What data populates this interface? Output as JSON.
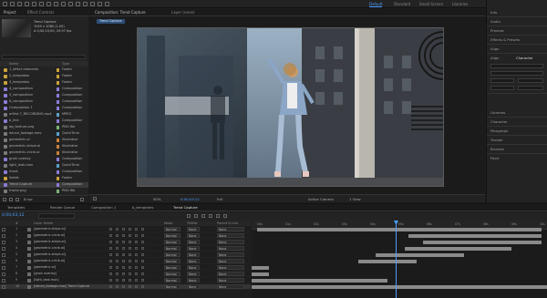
{
  "topbar": {
    "workspaces": [
      {
        "label": "Default",
        "active": true
      },
      {
        "label": "Standard",
        "active": false
      },
      {
        "label": "Small Screen",
        "active": false
      },
      {
        "label": "Libraries",
        "active": false
      }
    ],
    "search_label": "Search Help"
  },
  "project": {
    "tab_label": "Project",
    "effects_tab": "Effect Controls",
    "thumb_name": "Trend Capture",
    "thumb_line1": "1920 x 1080 (1.00)",
    "thumb_line2": "Δ 0;00;10;00, 29.97 fps",
    "header": {
      "name": "Name",
      "type": "Type"
    },
    "items": [
      {
        "name": "1_effect elements",
        "type": "Folder",
        "kind": "folder",
        "label_color": "#c9a23b"
      },
      {
        "name": "2_templates",
        "type": "Folder",
        "kind": "folder",
        "label_color": "#c9a23b"
      },
      {
        "name": "3_templates",
        "type": "Folder",
        "kind": "folder",
        "label_color": "#c9a23b"
      },
      {
        "name": "4_composition",
        "type": "Composition",
        "kind": "comp",
        "label_color": "#8c7bd6"
      },
      {
        "name": "5_composition",
        "type": "Composition",
        "kind": "comp",
        "label_color": "#8c7bd6"
      },
      {
        "name": "6_composition",
        "type": "Composition",
        "kind": "comp",
        "label_color": "#8c7bd6"
      },
      {
        "name": "Composition 1",
        "type": "Composition",
        "kind": "comp",
        "label_color": "#8c7bd6"
      },
      {
        "name": "artlist 7_RECORDING.mp4",
        "type": "MPEG",
        "kind": "file",
        "label_color": "#5aa0c8"
      },
      {
        "name": "b_line",
        "type": "Composition",
        "kind": "comp",
        "label_color": "#8c7bd6"
      },
      {
        "name": "bg_texture.png",
        "type": "PNG file",
        "kind": "file",
        "label_color": "#7ab37a"
      },
      {
        "name": "dance_footage.mov",
        "type": "QuickTime",
        "kind": "file",
        "label_color": "#5aa0c8"
      },
      {
        "name": "geometric.ai",
        "type": "Illustrator",
        "kind": "file",
        "label_color": "#c9803b"
      },
      {
        "name": "geometric-stripe.ai",
        "type": "Illustrator",
        "kind": "file",
        "label_color": "#c9803b"
      },
      {
        "name": "geometric-circle.ai",
        "type": "Illustrator",
        "kind": "file",
        "label_color": "#c9803b"
      },
      {
        "name": "grain overlay",
        "type": "Composition",
        "kind": "comp",
        "label_color": "#8c7bd6"
      },
      {
        "name": "light_leak.mov",
        "type": "QuickTime",
        "kind": "file",
        "label_color": "#5aa0c8"
      },
      {
        "name": "mask",
        "type": "Composition",
        "kind": "comp",
        "label_color": "#8c7bd6"
      },
      {
        "name": "Solids",
        "type": "Folder",
        "kind": "folder",
        "label_color": "#c9a23b"
      },
      {
        "name": "Trend Capture",
        "type": "Composition",
        "kind": "comp",
        "label_color": "#8c7bd6"
      },
      {
        "name": "frame.png",
        "type": "PNG file",
        "kind": "file",
        "label_color": "#7ab37a"
      }
    ],
    "bpc": "8 bpc"
  },
  "viewer": {
    "tab_label": "Composition: Trend Capture",
    "layer_tab": "Layer (none)",
    "breadcrumb": "Trend Capture",
    "footer": {
      "zoom": "50%",
      "timecode": "0;00;03;12",
      "resolution": "Full",
      "camera": "Active Camera",
      "views": "1 View"
    }
  },
  "rightpanel": {
    "items": [
      "Info",
      "Audio",
      "Preview",
      "Effects & Presets",
      "Align",
      "Libraries",
      "Character",
      "Paragraph",
      "Tracker",
      "Brushes",
      "Paint"
    ],
    "char_tabs": [
      "Align",
      "Character"
    ]
  },
  "timeline": {
    "tabs": [
      {
        "label": "Templates",
        "active": false
      },
      {
        "label": "Render Queue",
        "active": false
      },
      {
        "label": "Composition 1",
        "active": false
      },
      {
        "label": "b_templates",
        "active": false
      },
      {
        "label": "Trend Capture",
        "active": true
      }
    ],
    "timecode": "0;00;03;12",
    "columns": {
      "num": "#",
      "name": "Layer Name",
      "mode": "Mode",
      "trkmat": "TrkMat",
      "parent": "Parent & Link"
    },
    "ruler": [
      "00s",
      "01s",
      "02s",
      "03s",
      "04s",
      "05s",
      "06s",
      "07s",
      "08s",
      "09s",
      "10s"
    ],
    "layers": [
      {
        "num": "1",
        "name": "[geometric-stripe.ai]",
        "mode": "Normal",
        "trk": "None",
        "parent": "None",
        "bar_start": 0.02,
        "bar_end": 0.98
      },
      {
        "num": "2",
        "name": "[geometric-circle.ai]",
        "mode": "Normal",
        "trk": "None",
        "parent": "None",
        "bar_start": 0.53,
        "bar_end": 0.98
      },
      {
        "num": "3",
        "name": "[geometric-stripe.ai]",
        "mode": "Normal",
        "trk": "None",
        "parent": "None",
        "bar_start": 0.58,
        "bar_end": 0.98
      },
      {
        "num": "4",
        "name": "[geometric-circle.ai]",
        "mode": "Normal",
        "trk": "None",
        "parent": "None",
        "bar_start": 0.52,
        "bar_end": 0.88
      },
      {
        "num": "5",
        "name": "[geometric-stripe.ai]",
        "mode": "Normal",
        "trk": "None",
        "parent": "None",
        "bar_start": 0.42,
        "bar_end": 0.72
      },
      {
        "num": "6",
        "name": "[geometric-circle.ai]",
        "mode": "Normal",
        "trk": "None",
        "parent": "None",
        "bar_start": 0.36,
        "bar_end": 0.56
      },
      {
        "num": "7",
        "name": "[geometric.ai]",
        "mode": "Normal",
        "trk": "None",
        "parent": "None",
        "bar_start": 0.0,
        "bar_end": 0.06
      },
      {
        "num": "8",
        "name": "[grain overlay]",
        "mode": "Normal",
        "trk": "None",
        "parent": "None",
        "bar_start": 0.0,
        "bar_end": 0.06
      },
      {
        "num": "9",
        "name": "[light_leak.mov]",
        "mode": "Normal",
        "trk": "None",
        "parent": "None",
        "bar_start": 0.0,
        "bar_end": 0.46
      },
      {
        "num": "10",
        "name": "[dance_footage.mov] Trend Capture",
        "mode": "Normal",
        "trk": "None",
        "parent": "None",
        "bar_start": 0.0,
        "bar_end": 1.0
      }
    ]
  },
  "colors": {
    "accent": "#4a9eff",
    "panel_bg": "#232323",
    "bar": "#8a8a8a"
  }
}
